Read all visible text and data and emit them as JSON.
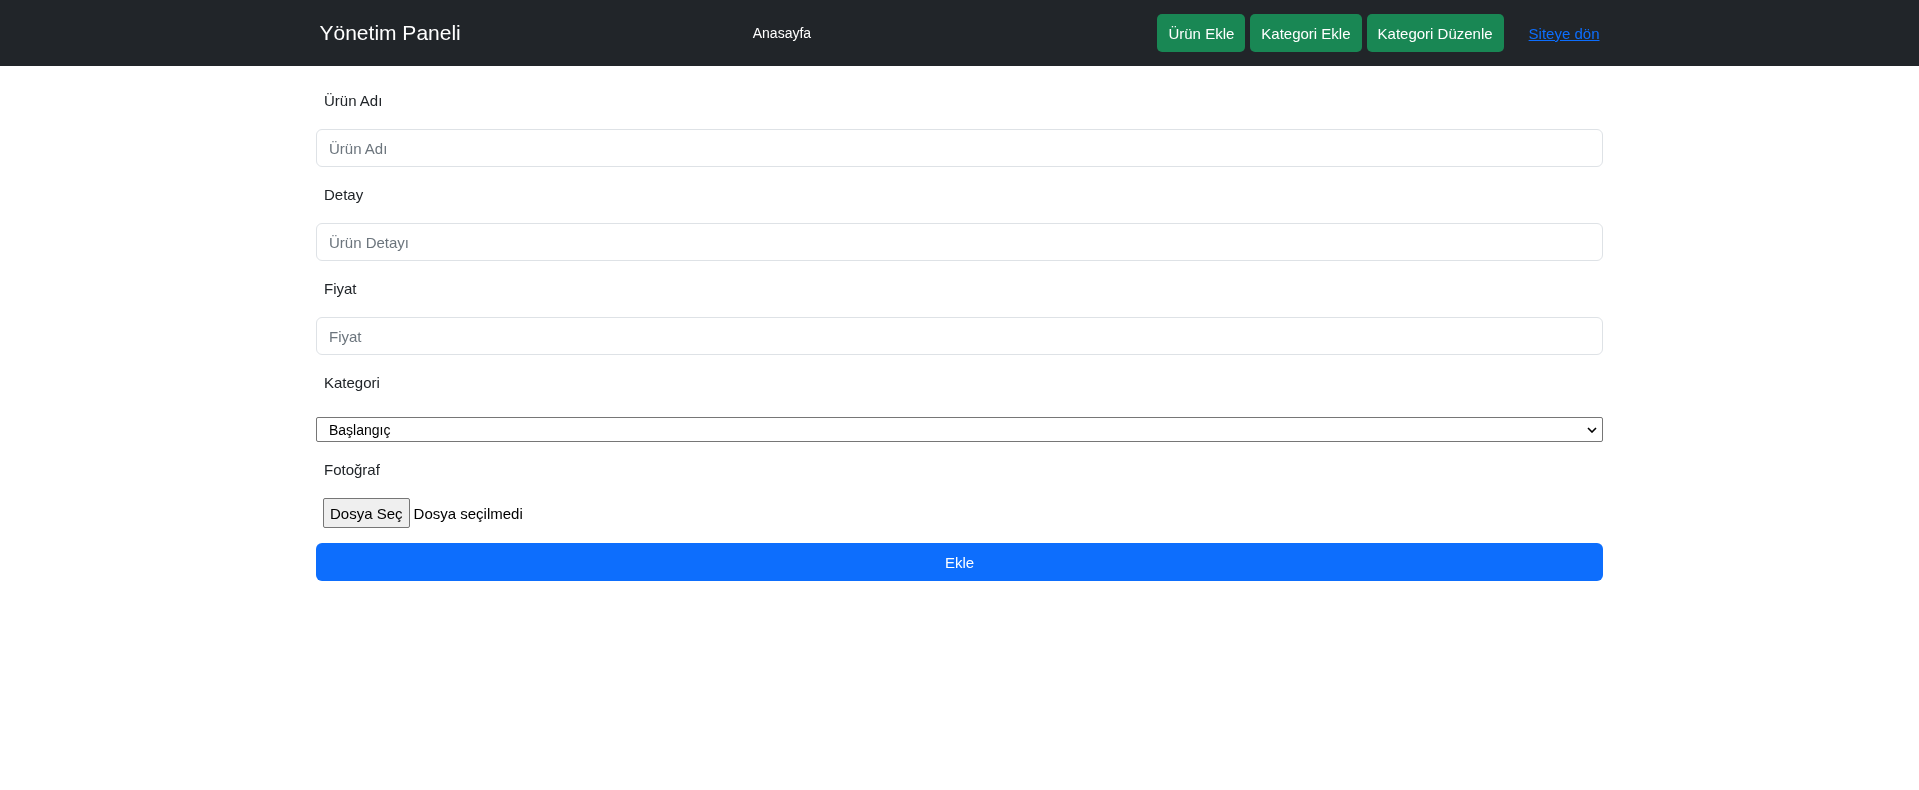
{
  "navbar": {
    "brand": "Yönetim Paneli",
    "nav_link": "Anasayfa",
    "buttons": [
      "Ürün Ekle",
      "Kategori Ekle",
      "Kategori Düzenle"
    ],
    "back_link": "Siteye dön"
  },
  "form": {
    "fields": [
      {
        "kind": "text",
        "label": "Ürün Adı",
        "placeholder": "Ürün Adı"
      },
      {
        "kind": "text",
        "label": "Detay",
        "placeholder": "Ürün Detayı"
      },
      {
        "kind": "text",
        "label": "Fiyat",
        "placeholder": "Fiyat"
      },
      {
        "kind": "select",
        "label": "Kategori",
        "value": "Başlangıç"
      },
      {
        "kind": "file",
        "label": "Fotoğraf",
        "button": "Dosya Seç",
        "status": "Dosya seçilmedi"
      }
    ],
    "submit": "Ekle"
  }
}
